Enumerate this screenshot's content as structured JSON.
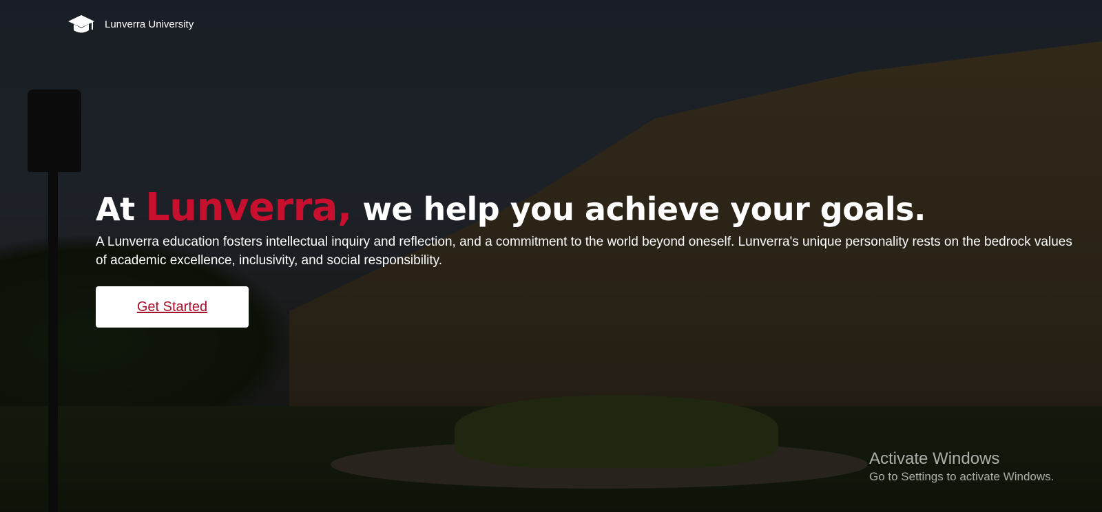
{
  "header": {
    "logo_icon": "graduation-cap-icon",
    "brand_name": "Lunverra University"
  },
  "hero": {
    "headline_prefix": "At ",
    "headline_accent": "Lunverra,",
    "headline_suffix": " we help you achieve your goals.",
    "description": "A Lunverra education fosters intellectual inquiry and reflection, and a commitment to the world beyond oneself. Lunverra's unique personality rests on the bedrock values of academic excellence, inclusivity, and social responsibility.",
    "cta_label": "Get Started"
  },
  "watermark": {
    "title": "Activate Windows",
    "subtitle": "Go to Settings to activate Windows."
  },
  "colors": {
    "accent": "#c8102e",
    "cta_text": "#a8102a",
    "cta_background": "#ffffff",
    "text": "#ffffff"
  }
}
